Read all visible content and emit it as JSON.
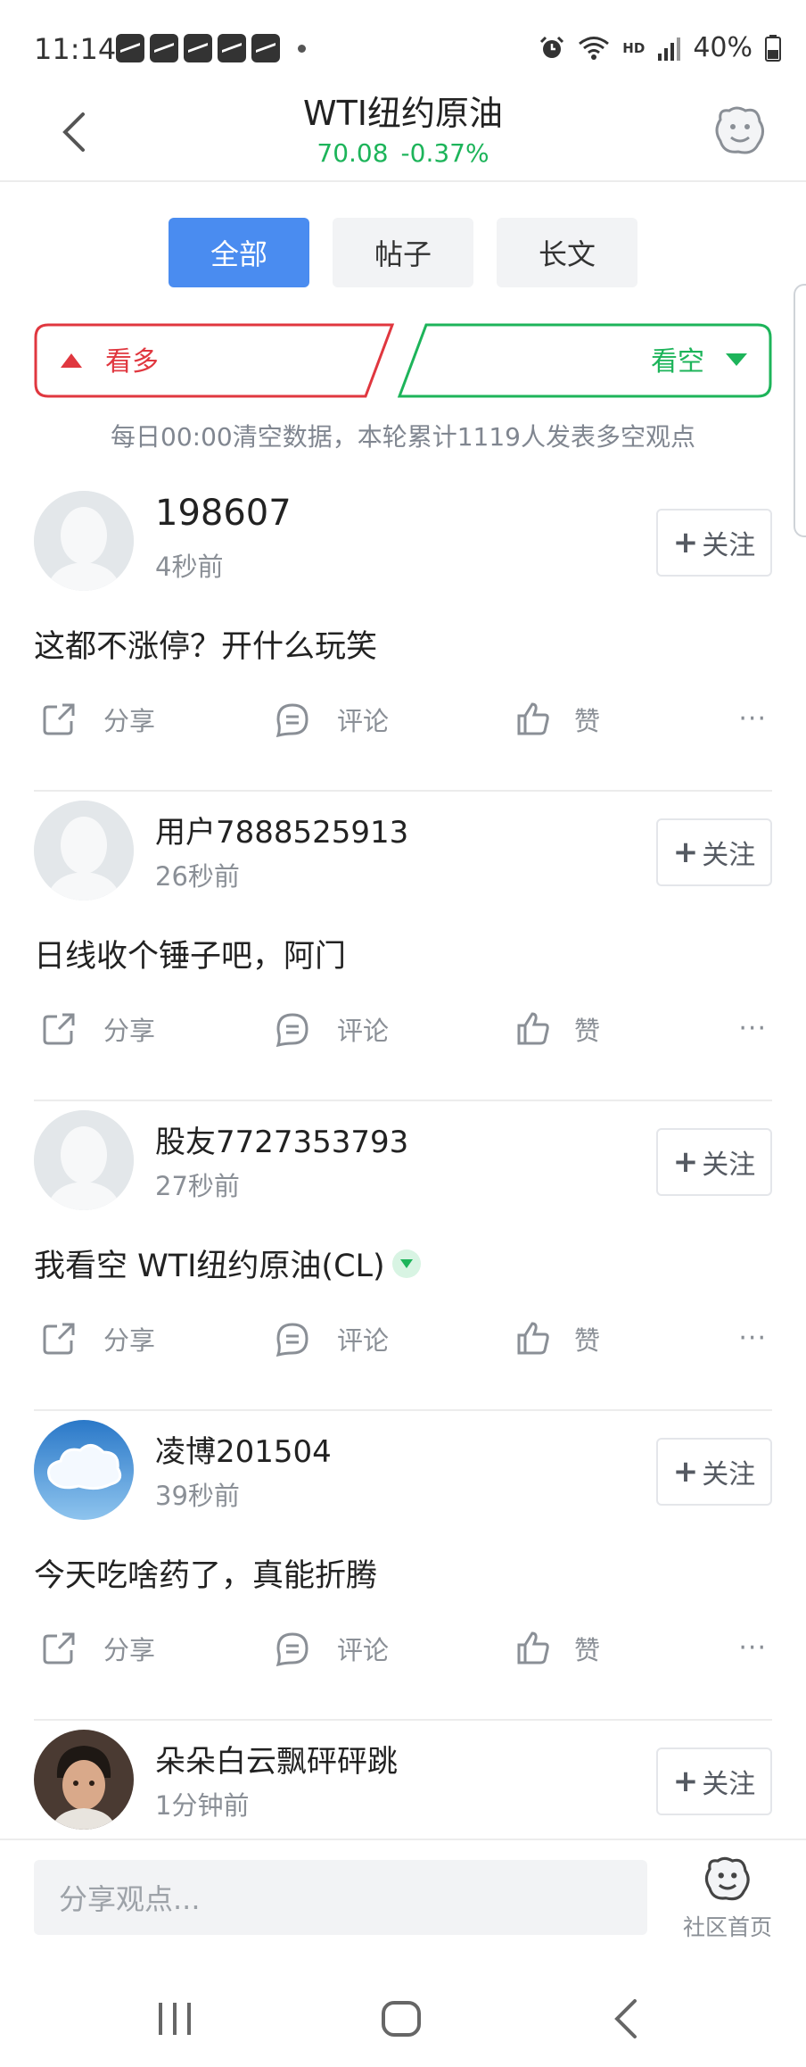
{
  "status_bar": {
    "time": "11:14",
    "hd": "HD",
    "battery": "40%"
  },
  "header": {
    "title": "WTI纽约原油",
    "price": "70.08",
    "change": "-0.37%"
  },
  "tabs": [
    {
      "label": "全部",
      "active": true
    },
    {
      "label": "帖子",
      "active": false
    },
    {
      "label": "长文",
      "active": false
    }
  ],
  "vote": {
    "bull_label": "看多",
    "bear_label": "看空",
    "notice": "每日00:00清空数据，本轮累计1119人发表多空观点"
  },
  "posts": [
    {
      "user": "198607",
      "time": "4秒前",
      "content": "这都不涨停？开什么玩笑",
      "follow": "关注",
      "bear_badge": false
    },
    {
      "user": "用户7888525913",
      "time": "26秒前",
      "content": "日线收个锤子吧，阿门",
      "follow": "关注",
      "bear_badge": false
    },
    {
      "user": "股友7727353793",
      "time": "27秒前",
      "content": "我看空 WTI纽约原油(CL)",
      "follow": "关注",
      "bear_badge": true
    },
    {
      "user": "凌博201504",
      "time": "39秒前",
      "content": "今天吃啥药了，真能折腾",
      "follow": "关注",
      "bear_badge": false
    },
    {
      "user": "朵朵白云飘砰砰跳",
      "time": "1分钟前",
      "content": "",
      "follow": "关注",
      "bear_badge": false
    }
  ],
  "actions": {
    "share": "分享",
    "comment": "评论",
    "like": "赞",
    "more": "···"
  },
  "bottom_bar": {
    "input_placeholder": "分享观点...",
    "community_home": "社区首页"
  },
  "colors": {
    "accent": "#4a8cf0",
    "bull": "#e0373f",
    "bear": "#1db45a"
  }
}
